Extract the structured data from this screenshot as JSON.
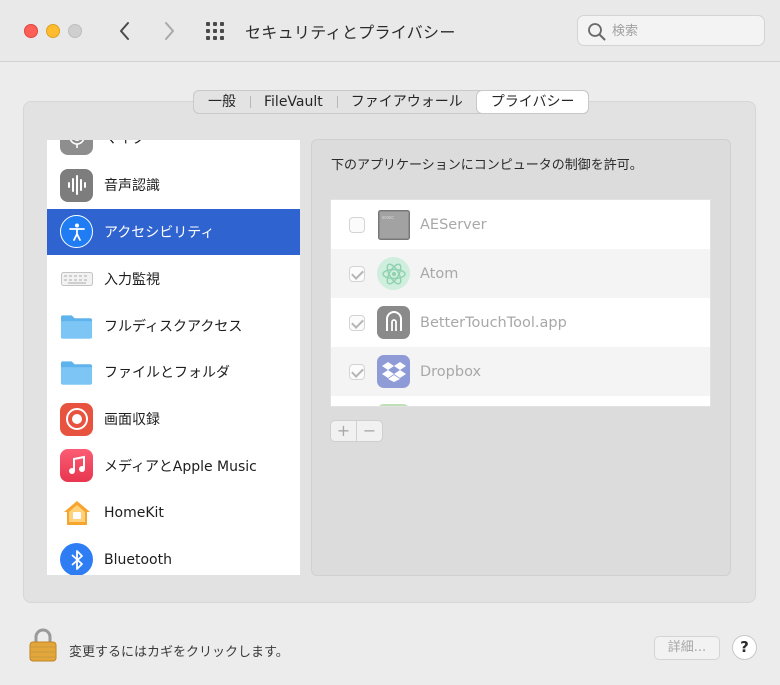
{
  "window": {
    "title": "セキュリティとプライバシー",
    "search_placeholder": "検索"
  },
  "tabs": [
    {
      "label": "一般",
      "active": false
    },
    {
      "label": "FileVault",
      "active": false
    },
    {
      "label": "ファイアウォール",
      "active": false
    },
    {
      "label": "プライバシー",
      "active": true
    }
  ],
  "sidebar": {
    "selected_index": 2,
    "items": [
      {
        "label": "マイク",
        "icon": "microphone-icon"
      },
      {
        "label": "音声認識",
        "icon": "waveform-icon"
      },
      {
        "label": "アクセシビリティ",
        "icon": "accessibility-icon"
      },
      {
        "label": "入力監視",
        "icon": "keyboard-icon"
      },
      {
        "label": "フルディスクアクセス",
        "icon": "folder-icon"
      },
      {
        "label": "ファイルとフォルダ",
        "icon": "folder-icon"
      },
      {
        "label": "画面収録",
        "icon": "record-icon"
      },
      {
        "label": "メディアとApple Music",
        "icon": "music-note-icon"
      },
      {
        "label": "HomeKit",
        "icon": "home-icon"
      },
      {
        "label": "Bluetooth",
        "icon": "bluetooth-icon"
      }
    ]
  },
  "main": {
    "heading": "下のアプリケーションにコンピュータの制御を許可。",
    "apps": [
      {
        "name": "AEServer",
        "checked": false,
        "icon": "terminal-icon"
      },
      {
        "name": "Atom",
        "checked": true,
        "icon": "atom-icon"
      },
      {
        "name": "BetterTouchTool.app",
        "checked": true,
        "icon": "bettertouchtool-icon"
      },
      {
        "name": "Dropbox",
        "checked": true,
        "icon": "dropbox-icon"
      }
    ],
    "add_label": "+",
    "remove_label": "−"
  },
  "footer": {
    "lock_text": "変更するにはカギをクリックします。",
    "details_label": "詳細...",
    "help_label": "?"
  },
  "colors": {
    "selection": "#2f63d0",
    "close": "#fe5f57",
    "minimize": "#febc2e"
  }
}
